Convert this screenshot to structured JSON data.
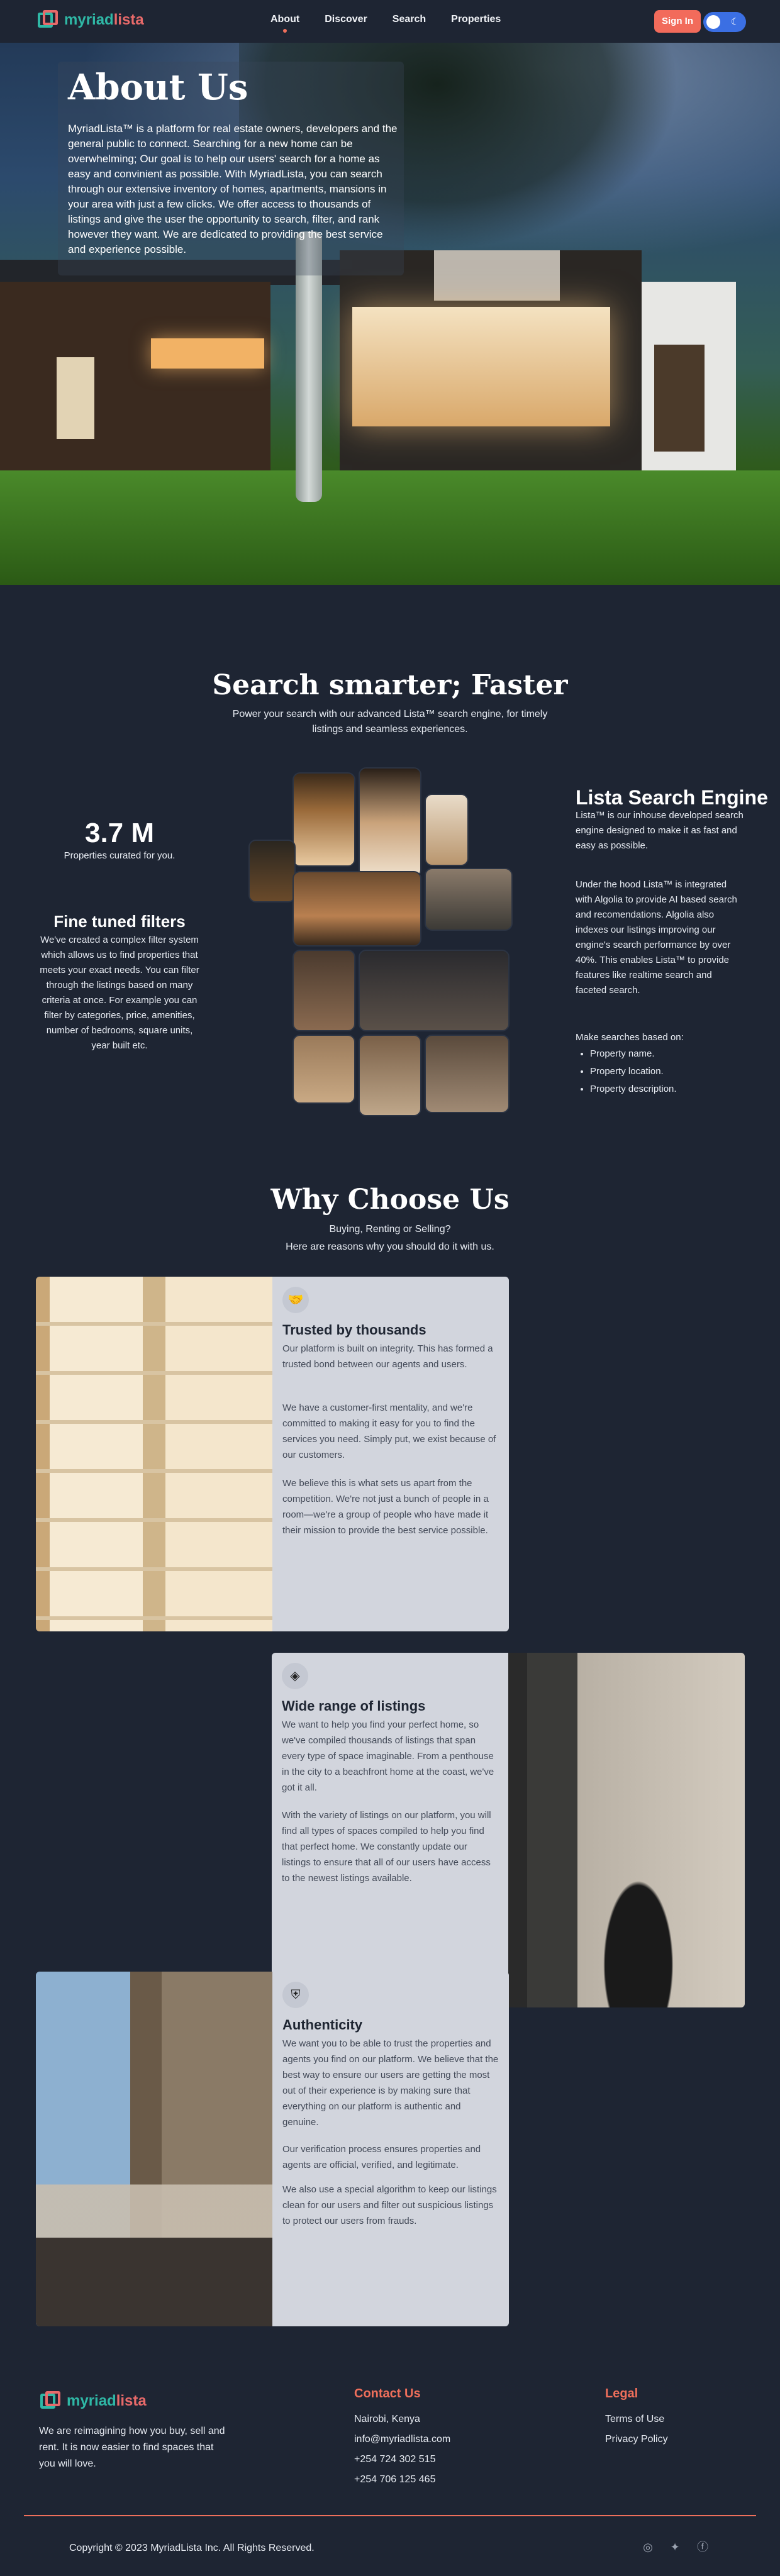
{
  "nav": {
    "logo": {
      "part1": "myriad",
      "part2": "lista"
    },
    "links": [
      "About",
      "Discover",
      "Search",
      "Properties"
    ],
    "active": "About",
    "sign_in": "Sign In",
    "theme_toggle_icon": "moon-icon"
  },
  "hero": {
    "title": "About Us",
    "text": "MyriadLista™ is a platform for real estate owners, developers and the general public to connect. Searching for a new home can be overwhelming; Our goal is to help our users' search for a home as easy and convinient as possible. With MyriadLista, you can search through our extensive inventory of homes, apartments, mansions in your area with just a few clicks. We offer access to thousands of listings and give the user the opportunity to search, filter, and rank however they want. We are dedicated to providing the best service and experience possible."
  },
  "search": {
    "title": "Search smarter; Faster",
    "subtitle": "Power your search with our advanced Lista™ search engine, for timely listings and seamless experiences.",
    "stat_value": "3.7 M",
    "stat_label": "Properties curated for you.",
    "filters_title": "Fine tuned filters",
    "filters_text": "We've created a complex filter system which allows us to find properties that meets your exact needs. You can filter through the listings based on many criteria at once. For example you can filter by categories, price, amenities, number of bedrooms, square units, year built etc.",
    "engine_title": "Lista Search Engine",
    "engine_p1": "Lista™ is our inhouse developed search engine designed to make it as fast and easy as possible.",
    "engine_p2": "Under the hood Lista™ is integrated with Algolia to provide AI based search and recomendations. Algolia also indexes our listings improving our engine's search performance by over 40%. This enables Lista™ to provide features like realtime search and faceted search.",
    "engine_p3": "Make searches based on:",
    "engine_list": [
      "Property name.",
      "Property location.",
      "Property description."
    ]
  },
  "why": {
    "title": "Why Choose Us",
    "subtitle_1": "Buying, Renting or Selling?",
    "subtitle_2": "Here are reasons why you should do it with us.",
    "features": [
      {
        "icon": "handshake-icon",
        "title": "Trusted by thousands",
        "paragraphs": [
          "Our platform is built on integrity. This has formed a trusted bond between our agents and users.",
          "We have a customer-first mentality, and we're committed to making it easy for you to find the services you need. Simply put, we exist because of our customers.",
          "We believe this is what sets us apart from the competition. We're not just a bunch of people in a room—we're a group of people who have made it their mission to provide the best service possible."
        ]
      },
      {
        "icon": "layers-icon",
        "title": "Wide range of listings",
        "paragraphs": [
          "We want to help you find your perfect home, so we've compiled thousands of listings that span every type of space imaginable. From a penthouse in the city to a beachfront home at the coast, we've got it all.",
          "With the variety of listings on our platform, you will find all types of spaces compiled to help you find that perfect home. We constantly update our listings to ensure that all of our users have access to the newest listings available."
        ]
      },
      {
        "icon": "shield-icon",
        "title": "Authenticity",
        "paragraphs": [
          "We want you to be able to trust the properties and agents you find on our platform. We believe that the best way to ensure our users are getting the most out of their experience is by making sure that everything on our platform is authentic and genuine.",
          "Our verification process ensures properties and agents are official, verified, and legitimate.",
          "We also use a special algorithm to keep our listings clean for our users and filter out suspicious listings to protect our users from frauds."
        ]
      }
    ]
  },
  "footer": {
    "logo": {
      "part1": "myriad",
      "part2": "lista"
    },
    "tagline": "We are reimagining how you buy, sell and rent. It is now easier to find spaces that you will love.",
    "contact_title": "Contact Us",
    "contact": [
      "Nairobi, Kenya",
      "info@myriadlista.com",
      "+254 724 302 515",
      "+254 706 125 465"
    ],
    "legal_title": "Legal",
    "legal": [
      "Terms of Use",
      "Privacy Policy"
    ],
    "copyright": "Copyright © 2023 MyriadLista Inc. All Rights Reserved.",
    "social_icons": [
      "instagram-icon",
      "twitter-icon",
      "facebook-icon"
    ]
  },
  "colors": {
    "background": "#1e2533",
    "accent": "#ef6f5b",
    "brand_teal": "#2fb8a6",
    "toggle": "#3b6fe3"
  }
}
